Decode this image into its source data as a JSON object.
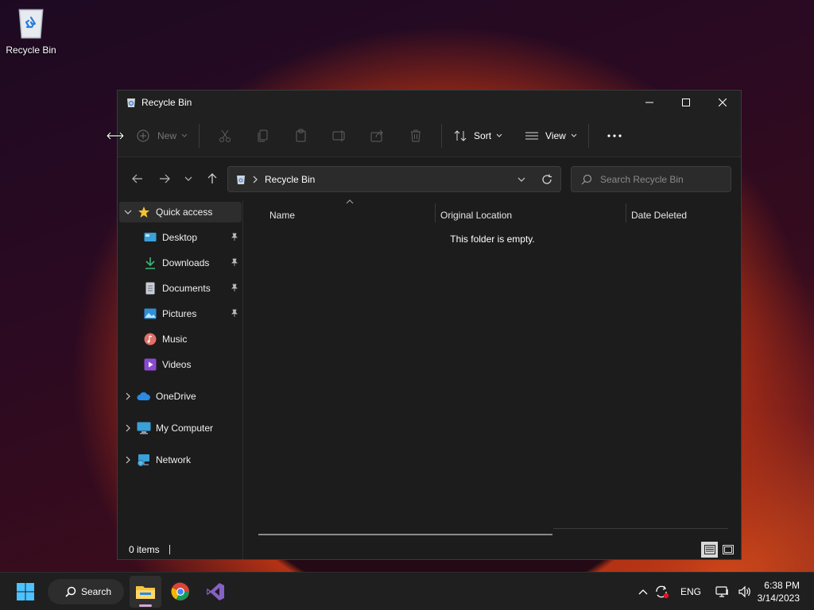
{
  "desktop": {
    "recycle_bin_label": "Recycle Bin"
  },
  "window": {
    "title": "Recycle Bin",
    "toolbar": {
      "new_label": "New",
      "sort_label": "Sort",
      "view_label": "View",
      "more_label": "..."
    },
    "address": {
      "crumb": "Recycle Bin"
    },
    "search": {
      "placeholder": "Search Recycle Bin"
    },
    "sidebar": {
      "items": [
        {
          "label": "Quick access",
          "icon": "star-icon"
        },
        {
          "label": "Desktop",
          "icon": "desktop-icon"
        },
        {
          "label": "Downloads",
          "icon": "download-icon"
        },
        {
          "label": "Documents",
          "icon": "document-icon"
        },
        {
          "label": "Pictures",
          "icon": "picture-icon"
        },
        {
          "label": "Music",
          "icon": "music-icon"
        },
        {
          "label": "Videos",
          "icon": "video-icon"
        },
        {
          "label": "OneDrive",
          "icon": "cloud-icon"
        },
        {
          "label": "My Computer",
          "icon": "computer-icon"
        },
        {
          "label": "Network",
          "icon": "network-icon"
        }
      ]
    },
    "columns": [
      "Name",
      "Original Location",
      "Date Deleted"
    ],
    "empty_message": "This folder is empty.",
    "status": {
      "item_count": "0 items"
    }
  },
  "taskbar": {
    "search_label": "Search",
    "language": "ENG",
    "time": "6:38 PM",
    "date": "3/14/2023"
  },
  "colors": {
    "window_bg": "#1c1c1c",
    "taskbar_bg": "#1f1f1f",
    "accent_underline": "#d7a8d6"
  }
}
